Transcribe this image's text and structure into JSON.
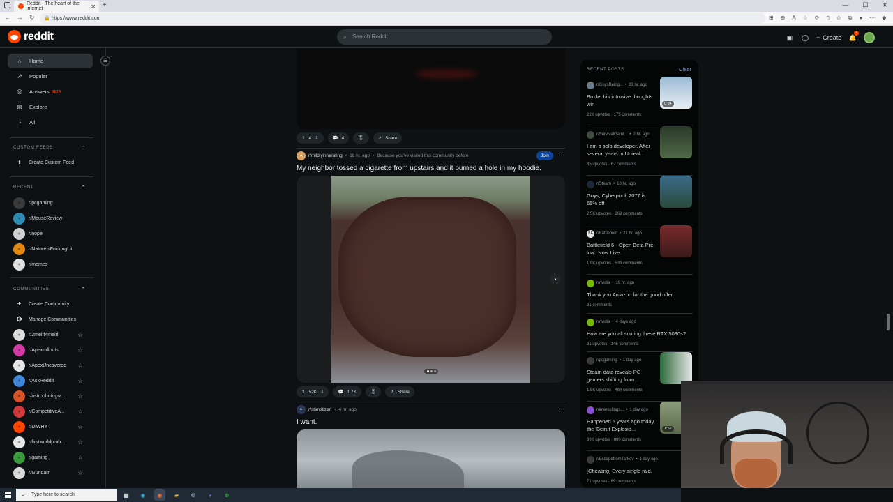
{
  "browser": {
    "tab_title": "Reddit - The heart of the internet",
    "url": "https://www.reddit.com"
  },
  "header": {
    "logo_text": "reddit",
    "search_placeholder": "Search Reddit",
    "create_label": "Create",
    "notification_count": "2"
  },
  "sidebar": {
    "nav": [
      {
        "label": "Home",
        "icon": "home-icon",
        "active": true
      },
      {
        "label": "Popular",
        "icon": "popular-icon"
      },
      {
        "label": "Answers",
        "icon": "answers-icon",
        "badge": "BETA"
      },
      {
        "label": "Explore",
        "icon": "explore-icon"
      },
      {
        "label": "All",
        "icon": "all-icon"
      }
    ],
    "custom_feeds_heading": "CUSTOM FEEDS",
    "create_custom_feed": "Create Custom Feed",
    "recent_heading": "RECENT",
    "recent": [
      {
        "name": "r/pcgaming",
        "color": "#3a3a3a"
      },
      {
        "name": "r/MouseReview",
        "color": "#2f8bb3"
      },
      {
        "name": "r/nope",
        "color": "#cfcfcf"
      },
      {
        "name": "r/NatureIsFuckingLit",
        "color": "#e3870e"
      },
      {
        "name": "r/memes",
        "color": "#e0e0e0"
      }
    ],
    "communities_heading": "COMMUNITIES",
    "create_community": "Create Community",
    "manage_communities": "Manage Communities",
    "communities": [
      {
        "name": "r/2meirl4meirl",
        "color": "#dcdcdc"
      },
      {
        "name": "r/Apexrollouts",
        "color": "#d33aa6"
      },
      {
        "name": "r/ApexUncovered",
        "color": "#e6e6e6"
      },
      {
        "name": "r/AskReddit",
        "color": "#3e86d6"
      },
      {
        "name": "r/astrophotogra...",
        "color": "#d9542b"
      },
      {
        "name": "r/CompetitiveA...",
        "color": "#d13a3a"
      },
      {
        "name": "r/DiWHY",
        "color": "#ff4500"
      },
      {
        "name": "r/firstworldprob...",
        "color": "#e6e6e6"
      },
      {
        "name": "r/gaming",
        "color": "#3b9a3b"
      },
      {
        "name": "r/Gundam",
        "color": "#d9d9d9"
      }
    ]
  },
  "feed": {
    "post1": {
      "votes": "4",
      "comments": "4",
      "share": "Share"
    },
    "post2": {
      "subreddit": "r/mildlyinfuriating",
      "time": "18 hr. ago",
      "reason": "Because you've visited this community before",
      "join": "Join",
      "title": "My neighbor tossed a cigarette from upstairs and it burned a hole in my hoodie.",
      "votes": "52K",
      "comments": "1.7K",
      "share": "Share"
    },
    "post3": {
      "subreddit": "r/starcitizen",
      "time": "4 hr. ago",
      "title": "I want."
    }
  },
  "recent_posts": {
    "heading": "RECENT POSTS",
    "clear": "Clear",
    "items": [
      {
        "sub": "r/GuysBeing...",
        "time": "23 hr. ago",
        "title": "Bro let his intrusive thoughts win",
        "upvotes": "22K upvotes",
        "comments": "175 comments",
        "thumb": "video",
        "duration": "0:34",
        "avatar_color": "#6b7d8a"
      },
      {
        "sub": "r/SurvivalGami...",
        "time": "7 hr. ago",
        "title": "I am a solo developer. After several years in Unreal...",
        "upvotes": "85 upvotes",
        "comments": "62 comments",
        "thumb": "image",
        "avatar_color": "#3f4a3f"
      },
      {
        "sub": "r/Steam",
        "time": "18 hr. ago",
        "title": "Guys, Cyberpunk 2077 is 65% off",
        "upvotes": "2.5K upvotes",
        "comments": "269 comments",
        "thumb": "image",
        "avatar_color": "#1b2838"
      },
      {
        "sub": "r/Battlefield",
        "time": "21 hr. ago",
        "title": "Battlefield 6 - Open Beta Pre-load Now Live.",
        "upvotes": "1.9K upvotes",
        "comments": "539 comments",
        "thumb": "image",
        "avatar_color": "#e6e6e6",
        "avatar_text": "BF"
      },
      {
        "sub": "r/nvidia",
        "time": "19 hr. ago",
        "title": "Thank you Amazon for the good offer.",
        "upvotes": "",
        "comments": "31 comments",
        "thumb": "none",
        "avatar_color": "#76b900"
      },
      {
        "sub": "r/nvidia",
        "time": "4 days ago",
        "title": "How are you all scoring these RTX 5090s?",
        "upvotes": "31 upvotes",
        "comments": "146 comments",
        "thumb": "none",
        "avatar_color": "#76b900"
      },
      {
        "sub": "r/pcgaming",
        "time": "1 day ago",
        "title": "Steam data reveals PC gamers shifting from...",
        "upvotes": "1.5K upvotes",
        "comments": "464 comments",
        "thumb": "image",
        "avatar_color": "#3a3a3a"
      },
      {
        "sub": "r/interestings...",
        "time": "1 day ago",
        "title": "Happened 5 years ago today, the 'Beirut Explosio...",
        "upvotes": "39K upvotes",
        "comments": "880 comments",
        "thumb": "video",
        "duration": "1:52",
        "avatar_color": "#8a4fd6"
      },
      {
        "sub": "r/EscapefromTarkov",
        "time": "1 day ago",
        "title": "[Cheating] Every single raid.",
        "upvotes": "71 upvotes",
        "comments": "69 comments",
        "thumb": "none",
        "avatar_color": "#3a3a3a"
      }
    ]
  },
  "taskbar": {
    "search_placeholder": "Type here to search"
  }
}
